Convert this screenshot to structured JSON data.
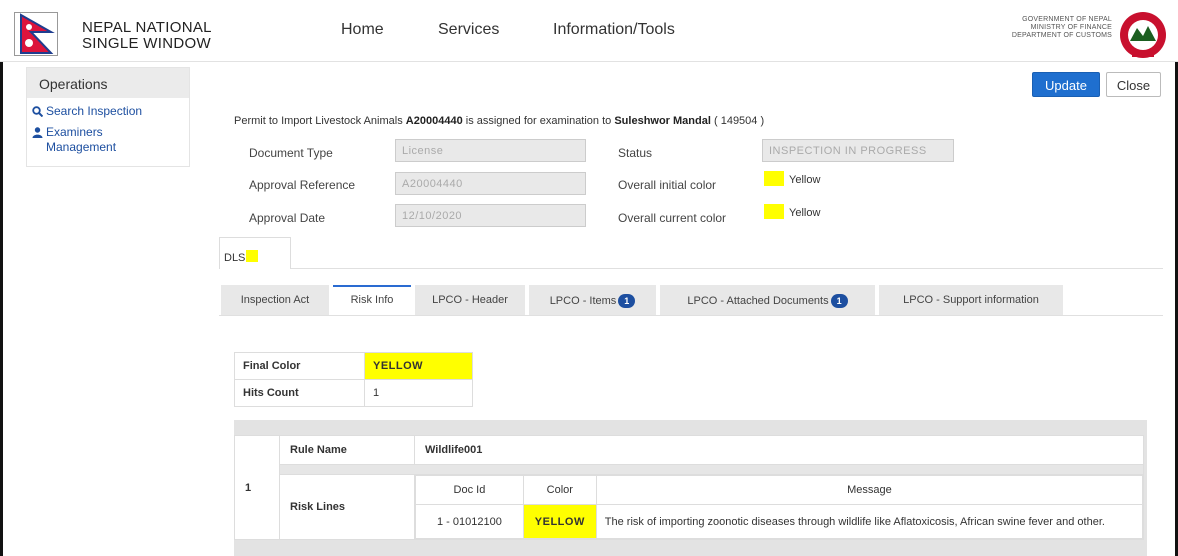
{
  "brand": {
    "line1": "NEPAL NATIONAL",
    "line2": "SINGLE WINDOW"
  },
  "nav": {
    "home": "Home",
    "services": "Services",
    "info": "Information/Tools"
  },
  "gov": {
    "line1": "GOVERNMENT OF NEPAL",
    "line2": "MINISTRY OF FINANCE",
    "line3": "DEPARTMENT OF CUSTOMS"
  },
  "sidebar": {
    "title": "Operations",
    "items": [
      {
        "label": "Search Inspection",
        "icon": "search-icon"
      },
      {
        "label": "Examiners Management",
        "icon": "user-icon"
      }
    ]
  },
  "actions": {
    "update": "Update",
    "close": "Close"
  },
  "assignment": {
    "prefix": "Permit to Import Livestock Animals",
    "permit_no": "A20004440",
    "middle": "is assigned for examination to",
    "examiner": "Suleshwor Mandal",
    "examiner_id": "( 149504 )"
  },
  "form": {
    "document_type_label": "Document Type",
    "document_type_value": "License",
    "approval_ref_label": "Approval Reference",
    "approval_ref_value": "A20004440",
    "approval_date_label": "Approval Date",
    "approval_date_value": "12/10/2020",
    "status_label": "Status",
    "status_value": "INSPECTION IN PROGRESS",
    "initial_color_label": "Overall initial color",
    "initial_color_value": "Yellow",
    "current_color_label": "Overall current color",
    "current_color_value": "Yellow"
  },
  "colors": {
    "yellow": "#ffff00",
    "primary": "#1f6fcf",
    "link": "#1d4fa0"
  },
  "tabs": {
    "dls": "DLS"
  },
  "subtabs": [
    {
      "label": "Inspection Act"
    },
    {
      "label": "Risk Info",
      "active": true
    },
    {
      "label": "LPCO - Header"
    },
    {
      "label": "LPCO - Items",
      "badge": "1"
    },
    {
      "label": "LPCO - Attached Documents",
      "badge": "1"
    },
    {
      "label": "LPCO - Support information"
    }
  ],
  "summary": {
    "final_color_label": "Final Color",
    "final_color_value": "YELLOW",
    "hits_label": "Hits Count",
    "hits_value": "1"
  },
  "rules": [
    {
      "index": "1",
      "rule_name_label": "Rule Name",
      "rule_name_value": "Wildlife001",
      "risk_lines_label": "Risk Lines",
      "headers": {
        "doc_id": "Doc Id",
        "color": "Color",
        "message": "Message"
      },
      "lines": [
        {
          "doc_id": "1 - 01012100",
          "color": "YELLOW",
          "message": "The risk of importing zoonotic diseases through wildlife like Aflatoxicosis, African swine fever and other."
        }
      ]
    }
  ]
}
